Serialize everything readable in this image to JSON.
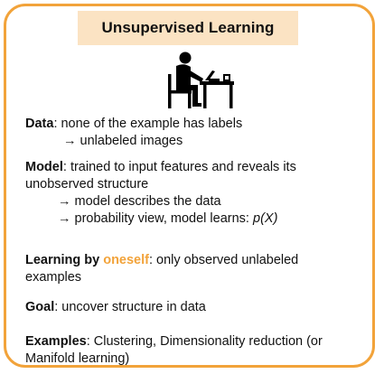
{
  "title": "Unsupervised Learning",
  "accent_color": "#f2a33a",
  "title_bg_color": "#fbe3c3",
  "illustration_icon": "person-at-desk-icon",
  "data_section": {
    "label": "Data",
    "text": ": none of the  example has labels",
    "sub": "→ unlabeled images"
  },
  "model_section": {
    "label": "Model",
    "text_line1": ": trained to input features and reveals its",
    "text_line2": "unobserved structure",
    "sub1": "→ model describes the data",
    "sub2_prefix": "→ probability view, model learns: ",
    "sub2_formula": "p(X)"
  },
  "learning_section": {
    "label": "Learning by ",
    "highlight": "oneself",
    "text_line1": ": only observed unlabeled",
    "text_line2": "examples"
  },
  "goal_section": {
    "label": "Goal",
    "text": ": uncover structure in data"
  },
  "examples_section": {
    "label": "Examples",
    "text_line1": ": Clustering, Dimensionality reduction (or",
    "text_line2": "Manifold learning)"
  }
}
